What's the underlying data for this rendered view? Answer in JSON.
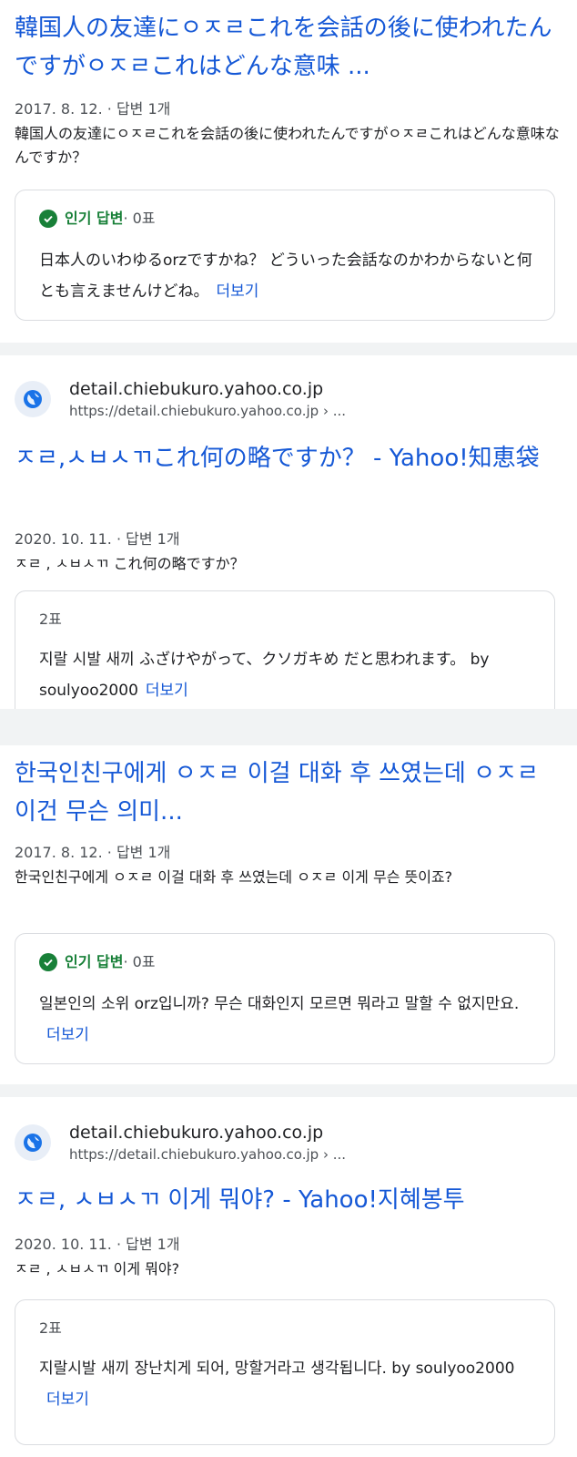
{
  "results": [
    {
      "title": "韓国人の友達にㅇㅈㄹこれを会話の後に使われたんですがㅇㅈㄹこれはどんな意味 ...",
      "meta": "2017. 8. 12. · 답변 1개",
      "snippet": "韓国人の友達にㅇㅈㄹこれを会話の後に使われたんですがㅇㅈㄹこれはどんな意味なんですか？",
      "card": {
        "badge": "인기 답변",
        "votes": " · 0표",
        "answer": "日本人のいわゆるorzですかね？ どういった会話なのかわからないと何とも言えませんけどね。",
        "more": "더보기"
      }
    },
    {
      "site_name": "detail.chiebukuro.yahoo.co.jp",
      "site_url": "https://detail.chiebukuro.yahoo.co.jp › ...",
      "title": "ㅈㄹ,ㅅㅂㅅㄲこれ何の略ですか？ - Yahoo!知恵袋",
      "meta": "2020. 10. 11. · 답변 1개",
      "snippet": "ㅈㄹ , ㅅㅂㅅㄲ これ何の略ですか？",
      "card": {
        "votes": "2표",
        "answer": "지랄 시발 새끼 ふざけやがって、クソガキめ だと思われます。 by soulyoo2000",
        "more": "더보기"
      }
    },
    {
      "title": "한국인친구에게 ㅇㅈㄹ 이걸 대화 후 쓰였는데 ㅇㅈㄹ 이건 무슨 의미...",
      "meta": "2017. 8. 12. · 답변 1개",
      "snippet": "한국인친구에게 ㅇㅈㄹ 이걸 대화 후 쓰였는데 ㅇㅈㄹ 이게 무슨 뜻이죠?",
      "card": {
        "badge": "인기 답변",
        "votes": " · 0표",
        "answer": "일본인의 소위 orz입니까? 무슨 대화인지 모르면 뭐라고 말할 수 없지만요.",
        "more": "더보기"
      }
    },
    {
      "site_name": "detail.chiebukuro.yahoo.co.jp",
      "site_url": "https://detail.chiebukuro.yahoo.co.jp › ...",
      "title": "ㅈㄹ, ㅅㅂㅅㄲ 이게 뭐야? - Yahoo!지혜봉투",
      "meta": "2020. 10. 11. · 답변 1개",
      "snippet": "ㅈㄹ , ㅅㅂㅅㄲ 이게 뭐야?",
      "card": {
        "votes": "2표",
        "answer": "지랄시발 새끼 장난치게 되어, 망할거라고 생각됩니다. by soulyoo2000",
        "more": "더보기"
      }
    }
  ],
  "colors": {
    "link": "#1558d6",
    "popular": "#188038",
    "divider": "#f1f3f4"
  },
  "icons": {
    "site": "globe-icon",
    "badge": "check-circle-icon"
  }
}
